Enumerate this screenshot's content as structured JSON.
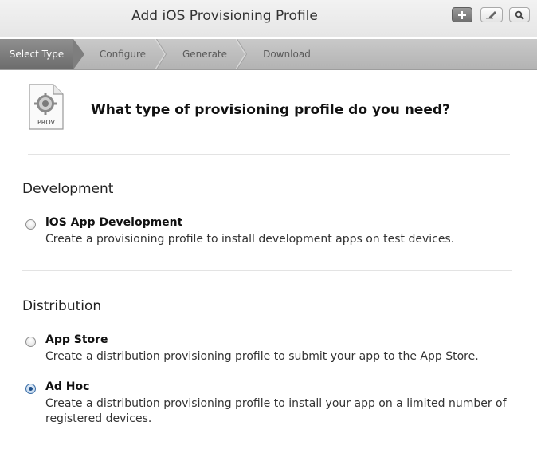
{
  "window": {
    "title": "Add iOS Provisioning Profile"
  },
  "toolbar": {
    "add_icon": "plus-icon",
    "edit_icon": "pencil-icon",
    "search_icon": "magnifier-icon"
  },
  "steps": [
    {
      "label": "Select Type",
      "active": true
    },
    {
      "label": "Configure",
      "active": false
    },
    {
      "label": "Generate",
      "active": false
    },
    {
      "label": "Download",
      "active": false
    }
  ],
  "header": {
    "icon_label": "PROV",
    "question": "What type of provisioning profile do you need?"
  },
  "development": {
    "title": "Development",
    "options": [
      {
        "title": "iOS App Development",
        "description": "Create a provisioning profile to install development apps on test devices.",
        "selected": false
      }
    ]
  },
  "distribution": {
    "title": "Distribution",
    "options": [
      {
        "title": "App Store",
        "description": "Create a distribution provisioning profile to submit your app to the App Store.",
        "selected": false
      },
      {
        "title": "Ad Hoc",
        "description": "Create a distribution provisioning profile to install your app on a limited number of registered devices.",
        "selected": true
      }
    ]
  },
  "colors": {
    "accent_radio": "#1d4f8a",
    "active_step": "#7e7e7e"
  }
}
